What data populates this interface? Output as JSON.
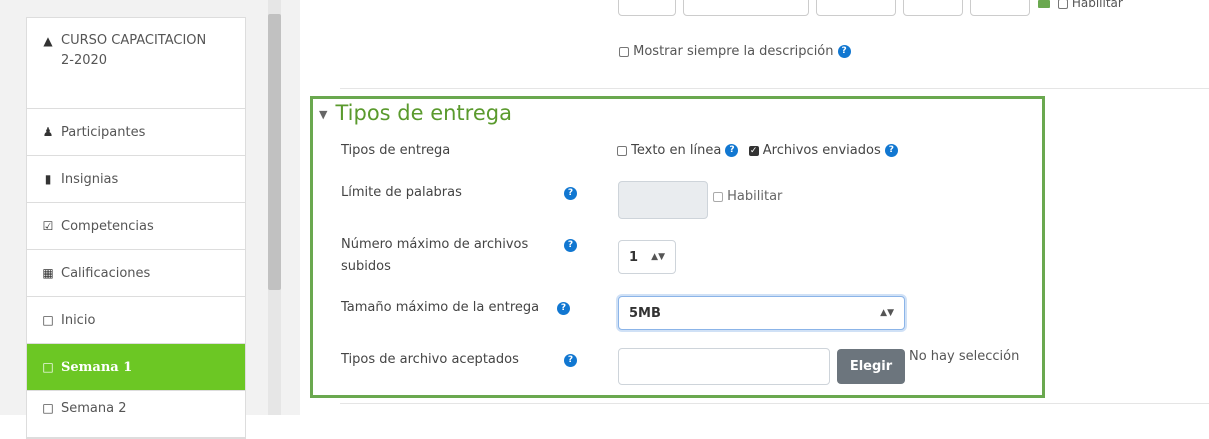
{
  "sidebar": {
    "course": "CURSO CAPACITACION 2-2020",
    "items": [
      {
        "label": "Participantes",
        "icon": "users-icon"
      },
      {
        "label": "Insignias",
        "icon": "shield-icon"
      },
      {
        "label": "Competencias",
        "icon": "checkbox-icon"
      },
      {
        "label": "Calificaciones",
        "icon": "table-icon"
      },
      {
        "label": "Inicio",
        "icon": "folder-icon"
      },
      {
        "label": "Semana 1",
        "icon": "folder-icon",
        "active": true
      },
      {
        "label": "Semana 2",
        "icon": "folder-icon"
      }
    ]
  },
  "top": {
    "habilitar": "Habilitar",
    "show_description": "Mostrar siempre la descripción"
  },
  "section": {
    "title": "Tipos de entrega",
    "submission_types_label": "Tipos de entrega",
    "online_text": "Texto en línea",
    "online_text_checked": false,
    "files_submitted": "Archivos enviados",
    "files_submitted_checked": true,
    "word_limit_label": "Límite de palabras",
    "word_limit_enable": "Habilitar",
    "max_files_label": "Número máximo de archivos subidos",
    "max_files_value": "1",
    "max_size_label": "Tamaño máximo de la entrega",
    "max_size_value": "5MB",
    "accepted_types_label": "Tipos de archivo aceptados",
    "choose_button": "Elegir",
    "no_selection": "No hay selección"
  },
  "colors": {
    "accent": "#6cc724",
    "section_border": "#6aa84f",
    "help": "#1177d1"
  }
}
